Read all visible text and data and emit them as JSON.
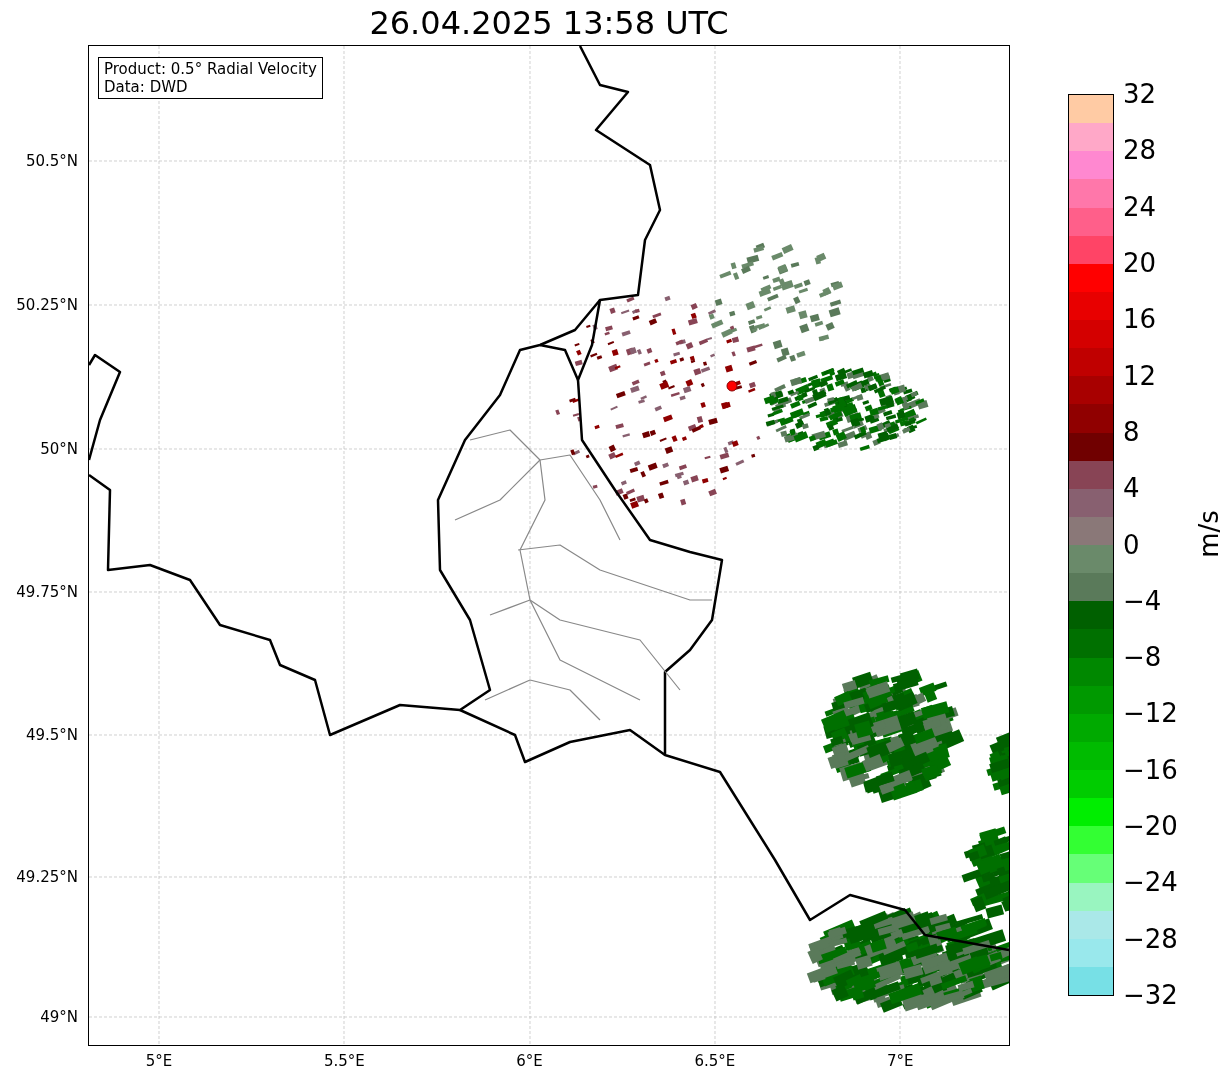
{
  "title": "26.04.2025 13:58 UTC",
  "map": {
    "info_box": [
      "Product: 0.5° Radial Velocity",
      "Data: DWD"
    ],
    "lat_ticks": [
      "50.5°N",
      "50.25°N",
      "50°N",
      "49.75°N",
      "49.5°N",
      "49.25°N",
      "49°N"
    ],
    "lon_ticks": [
      "5°E",
      "5.5°E",
      "6°E",
      "6.5°E",
      "7°E"
    ]
  },
  "colorbar": {
    "label": "m/s",
    "ticks": [
      "32",
      "28",
      "24",
      "20",
      "16",
      "12",
      "8",
      "4",
      "0",
      "−4",
      "−8",
      "−12",
      "−16",
      "−20",
      "−24",
      "−28",
      "−32"
    ],
    "bins": [
      {
        "color": "#ffcba4"
      },
      {
        "color": "#ffa8c8"
      },
      {
        "color": "#ff88d0"
      },
      {
        "color": "#ff77aa"
      },
      {
        "color": "#ff5f8a"
      },
      {
        "color": "#ff4466"
      },
      {
        "color": "#ff0000"
      },
      {
        "color": "#e80000"
      },
      {
        "color": "#d40000"
      },
      {
        "color": "#c00000"
      },
      {
        "color": "#a80000"
      },
      {
        "color": "#900000"
      },
      {
        "color": "#700000"
      },
      {
        "color": "#884455"
      },
      {
        "color": "#886070"
      },
      {
        "color": "#8a7878"
      },
      {
        "color": "#6a8a6a"
      },
      {
        "color": "#5a7a5a"
      },
      {
        "color": "#006000"
      },
      {
        "color": "#007000"
      },
      {
        "color": "#008800"
      },
      {
        "color": "#009900"
      },
      {
        "color": "#00aa00"
      },
      {
        "color": "#00bb00"
      },
      {
        "color": "#00cc00"
      },
      {
        "color": "#00ee00"
      },
      {
        "color": "#33ff33"
      },
      {
        "color": "#66ff77"
      },
      {
        "color": "#99f5c0"
      },
      {
        "color": "#aae8e8"
      },
      {
        "color": "#99e8ec"
      },
      {
        "color": "#77e0e6"
      }
    ]
  }
}
